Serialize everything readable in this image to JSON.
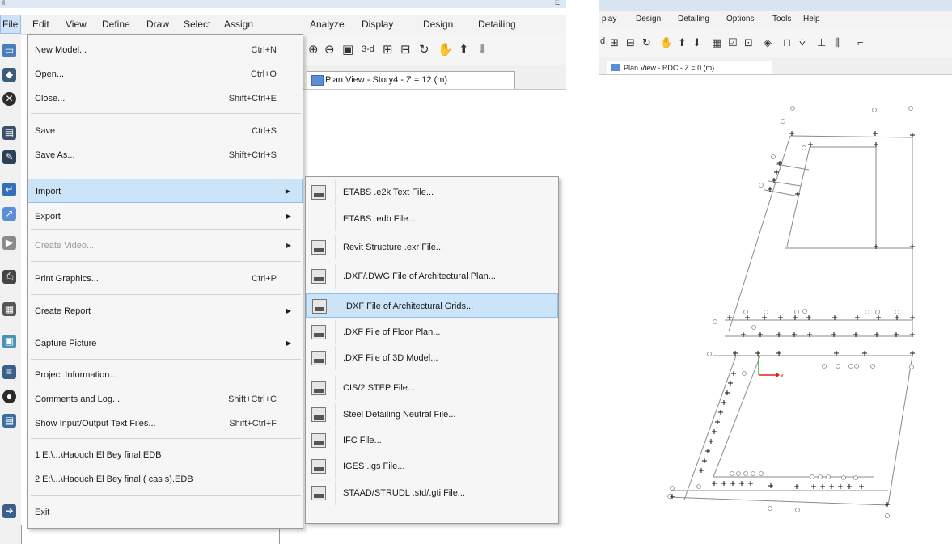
{
  "left": {
    "title_letter": "il",
    "title_right_letter": "E",
    "menubar": [
      "File",
      "Edit",
      "View",
      "Define",
      "Draw",
      "Select",
      "Assign",
      "Analyze",
      "Display",
      "Design",
      "Detailing"
    ],
    "toolbar_text": "3-d",
    "tab_title": "Plan View - Story4 - Z = 12 (m)",
    "file_menu": [
      {
        "label": "New Model...",
        "shortcut": "Ctrl+N"
      },
      {
        "label": "Open...",
        "shortcut": "Ctrl+O"
      },
      {
        "label": "Close...",
        "shortcut": "Shift+Ctrl+E"
      },
      {
        "label": "Save",
        "shortcut": "Ctrl+S"
      },
      {
        "label": "Save As...",
        "shortcut": "Shift+Ctrl+S"
      },
      {
        "label": "Import",
        "shortcut": ""
      },
      {
        "label": "Export",
        "shortcut": ""
      },
      {
        "label": "Create Video...",
        "shortcut": ""
      },
      {
        "label": "Print Graphics...",
        "shortcut": "Ctrl+P"
      },
      {
        "label": "Create Report",
        "shortcut": ""
      },
      {
        "label": "Capture Picture",
        "shortcut": ""
      },
      {
        "label": "Project Information...",
        "shortcut": ""
      },
      {
        "label": "Comments and Log...",
        "shortcut": "Shift+Ctrl+C"
      },
      {
        "label": "Show Input/Output Text Files...",
        "shortcut": "Shift+Ctrl+F"
      },
      {
        "label": "1 E:\\...\\Haouch El Bey final.EDB",
        "shortcut": ""
      },
      {
        "label": "2 E:\\...\\Haouch El Bey final ( cas s).EDB",
        "shortcut": ""
      },
      {
        "label": "Exit",
        "shortcut": ""
      }
    ],
    "import_submenu": [
      "ETABS .e2k Text File...",
      "ETABS .edb File...",
      "Revit Structure .exr File...",
      ".DXF/.DWG File of Architectural Plan...",
      ".DXF File of Architectural Grids...",
      ".DXF File of Floor Plan...",
      ".DXF File of 3D Model...",
      "CIS/2 STEP File...",
      "Steel Detailing Neutral File...",
      "IFC File...",
      "IGES .igs File...",
      "STAAD/STRUDL .std/.gti File..."
    ]
  },
  "right": {
    "menubar": [
      "play",
      "Design",
      "Detailing",
      "Options",
      "Tools",
      "Help"
    ],
    "toolbar_text": "d",
    "tab_title": "Plan View - RDC - Z = 0 (m)",
    "axis_x": "x"
  }
}
